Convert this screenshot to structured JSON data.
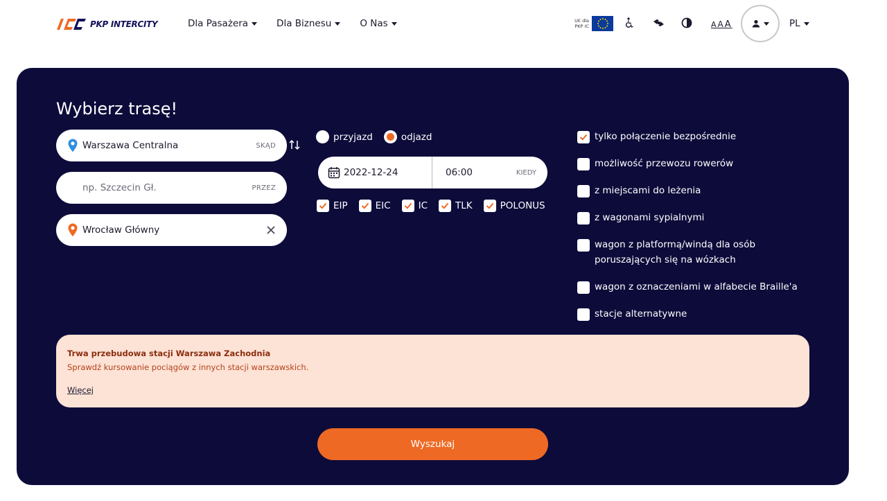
{
  "header": {
    "logo_text": "PKP INTERCITY",
    "nav": [
      {
        "label": "Dla Pasażera"
      },
      {
        "label": "Dla Biznesu"
      },
      {
        "label": "O Nas"
      }
    ],
    "ue_text_line1": "UE dla",
    "ue_text_line2": "PKP IC",
    "font_size_a1": "A",
    "font_size_a2": "A",
    "font_size_a3": "A",
    "language": "PL",
    "icons": [
      "eu-flag-icon",
      "wheelchair-icon",
      "sign-language-icon",
      "contrast-icon",
      "user-icon"
    ]
  },
  "search": {
    "title": "Wybierz trasę!",
    "from": {
      "value": "Warszawa Centralna",
      "suffix": "SKĄD"
    },
    "via": {
      "placeholder": "np. Szczecin Gł.",
      "suffix": "PRZEZ"
    },
    "to": {
      "value": "Wrocław Główny"
    },
    "mode": {
      "options": [
        {
          "label": "przyjazd",
          "selected": false
        },
        {
          "label": "odjazd",
          "selected": true
        }
      ]
    },
    "date": "2022-12-24",
    "time": "06:00",
    "time_suffix": "KIEDY",
    "categories": [
      {
        "label": "EIP",
        "checked": true
      },
      {
        "label": "EIC",
        "checked": true
      },
      {
        "label": "IC",
        "checked": true
      },
      {
        "label": "TLK",
        "checked": true
      },
      {
        "label": "POLONUS",
        "checked": true
      }
    ],
    "options": [
      {
        "label": "tylko połączenie bezpośrednie",
        "checked": true
      },
      {
        "label": "możliwość przewozu rowerów",
        "checked": false
      },
      {
        "label": "z miejscami do leżenia",
        "checked": false
      },
      {
        "label": "z wagonami sypialnymi",
        "checked": false
      },
      {
        "label": "wagon z platformą/windą dla osób poruszających się na wózkach",
        "checked": false
      },
      {
        "label": "wagon z oznaczeniami w alfabecie Braille'a",
        "checked": false
      },
      {
        "label": "stacje alternatywne",
        "checked": false
      }
    ],
    "notice": {
      "title": "Trwa przebudowa stacji Warszawa Zachodnia",
      "body": "Sprawdź kursowanie pociągów z innych stacji warszawskich.",
      "link": "Więcej"
    },
    "submit_label": "Wyszukaj"
  },
  "colors": {
    "card_bg": "#0d0b3a",
    "accent": "#ee6a24",
    "from_pin": "#2f8fe0",
    "notice_bg": "#fde2d6"
  }
}
